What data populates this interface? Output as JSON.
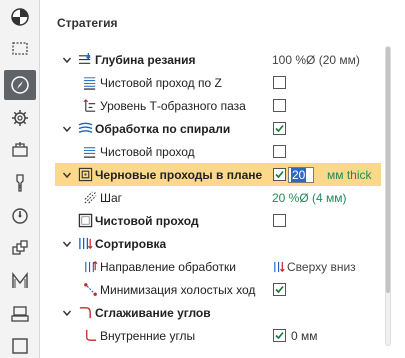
{
  "panel": {
    "title": "Стратегия"
  },
  "toolbar": [
    {
      "name": "quadrant-circle-icon",
      "active": false
    },
    {
      "name": "dashed-box-icon",
      "active": false
    },
    {
      "name": "strategy-compass-icon",
      "active": true
    },
    {
      "name": "gear-icon",
      "active": false
    },
    {
      "name": "stock-setup-icon",
      "active": false
    },
    {
      "name": "tool-icon",
      "active": false
    },
    {
      "name": "speed-icon",
      "active": false
    },
    {
      "name": "links-icon",
      "active": false
    },
    {
      "name": "m-macro-icon",
      "active": false
    },
    {
      "name": "clamp-icon",
      "active": false
    },
    {
      "name": "empty-box-icon",
      "active": false
    }
  ],
  "rows": {
    "depth": {
      "label": "Глубина резания",
      "value": "100 %Ø (20 мм)"
    },
    "finish_z": {
      "label": "Чистовой проход по Z",
      "checked": false
    },
    "t_slot": {
      "label": "Уровень Т-образного паза",
      "checked": false
    },
    "spiral": {
      "label": "Обработка по спирали",
      "checked": true
    },
    "spiral_finish": {
      "label": "Чистовой проход",
      "checked": false
    },
    "roughing": {
      "label": "Черновые проходы в плане",
      "checked": true,
      "input": "20",
      "unit": "мм thick"
    },
    "step": {
      "label": "Шаг",
      "value": "20 %Ø (4 мм)"
    },
    "finish": {
      "label": "Чистовой проход",
      "checked": false
    },
    "sort": {
      "label": "Сортировка"
    },
    "direction": {
      "label": "Направление обработки",
      "value": "Сверху вниз"
    },
    "minimize": {
      "label": "Минимизация холостых ход",
      "checked": true
    },
    "smoothing": {
      "label": "Сглаживание углов"
    },
    "inner_corners": {
      "label": "Внутренние углы",
      "checked": true,
      "after": "0 мм"
    }
  }
}
